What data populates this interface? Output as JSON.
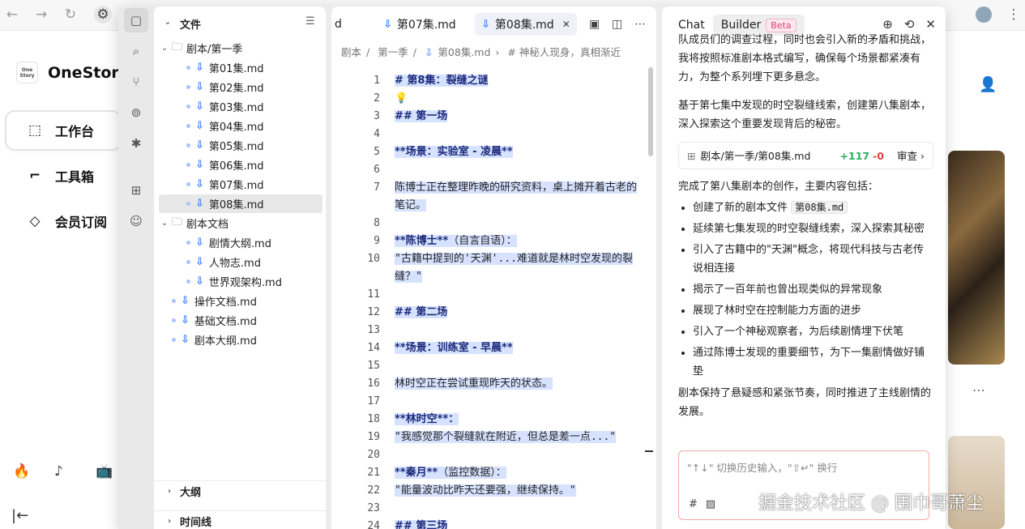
{
  "background": {
    "logo_small": "One Story",
    "logo_text": "OneStory",
    "menu": [
      "工作台",
      "工具箱",
      "会员订阅"
    ]
  },
  "explorer": {
    "header": "文件",
    "tree": [
      {
        "label": "剧本/第一季",
        "kind": "folder-open",
        "level": 0
      },
      {
        "label": "第01集.md",
        "kind": "file",
        "level": 1
      },
      {
        "label": "第02集.md",
        "kind": "file",
        "level": 1
      },
      {
        "label": "第03集.md",
        "kind": "file",
        "level": 1
      },
      {
        "label": "第04集.md",
        "kind": "file",
        "level": 1
      },
      {
        "label": "第05集.md",
        "kind": "file",
        "level": 1
      },
      {
        "label": "第06集.md",
        "kind": "file",
        "level": 1
      },
      {
        "label": "第07集.md",
        "kind": "file",
        "level": 1
      },
      {
        "label": "第08集.md",
        "kind": "file",
        "level": 1,
        "selected": true
      },
      {
        "label": "剧本文档",
        "kind": "folder-open",
        "level": 0
      },
      {
        "label": "剧情大纲.md",
        "kind": "file",
        "level": 1
      },
      {
        "label": "人物志.md",
        "kind": "file",
        "level": 1
      },
      {
        "label": "世界观架构.md",
        "kind": "file",
        "level": 1
      },
      {
        "label": "操作文档.md",
        "kind": "file",
        "level": 0
      },
      {
        "label": "基础文档.md",
        "kind": "file",
        "level": 0
      },
      {
        "label": "剧本大纲.md",
        "kind": "file",
        "level": 0
      }
    ],
    "sections": [
      "大纲",
      "时间线"
    ]
  },
  "editor": {
    "tab_prev_fragment": "d",
    "tab_prev": "第07集.md",
    "tab_active": "第08集.md",
    "breadcrumb": [
      "剧本",
      "第一季",
      "第08集.md",
      "# 神秘人现身，真相渐近"
    ],
    "lines": [
      {
        "n": "1",
        "text": "# 第8集：裂缝之谜",
        "style": "b"
      },
      {
        "n": "2",
        "text": "💡",
        "style": "bulb"
      },
      {
        "n": "3",
        "text": "## 第一场",
        "style": "b"
      },
      {
        "n": "4",
        "text": "",
        "style": ""
      },
      {
        "n": "5",
        "text": "**场景：实验室 - 凌晨**",
        "style": "b"
      },
      {
        "n": "6",
        "text": "",
        "style": ""
      },
      {
        "n": "7",
        "text": "陈博士正在整理昨晚的研究资料，桌上摊开着古老的",
        "cont": "笔记。",
        "style": ""
      },
      {
        "n": "8",
        "text": "",
        "style": ""
      },
      {
        "n": "9",
        "text": "**陈博士**",
        "suffix": "（自言自语）：",
        "style": "b"
      },
      {
        "n": "10",
        "text": "\"古籍中提到的'天渊'...难道就是林时空发现的裂",
        "cont": "缝？\"",
        "style": "mono"
      },
      {
        "n": "11",
        "text": "",
        "style": ""
      },
      {
        "n": "12",
        "text": "## 第二场",
        "style": "b"
      },
      {
        "n": "13",
        "text": "",
        "style": ""
      },
      {
        "n": "14",
        "text": "**场景：训练室 - 早晨**",
        "style": "b"
      },
      {
        "n": "15",
        "text": "",
        "style": ""
      },
      {
        "n": "16",
        "text": "林时空正在尝试重现昨天的状态。",
        "style": ""
      },
      {
        "n": "17",
        "text": "",
        "style": ""
      },
      {
        "n": "18",
        "text": "**林时空**：",
        "style": "b"
      },
      {
        "n": "19",
        "text": "\"我感觉那个裂缝就在附近，但总是差一点...\"",
        "style": "mono"
      },
      {
        "n": "20",
        "text": "",
        "style": ""
      },
      {
        "n": "21",
        "text": "**秦月**",
        "suffix": "（监控数据）：",
        "style": "b"
      },
      {
        "n": "22",
        "text": "\"能量波动比昨天还要强，继续保持。\"",
        "style": "mono"
      },
      {
        "n": "23",
        "text": "",
        "style": ""
      },
      {
        "n": "24",
        "text": "## 第三场",
        "style": "b"
      }
    ]
  },
  "chat": {
    "tab_chat": "Chat",
    "tab_builder": "Builder",
    "beta": "Beta",
    "intro_fragment": "队成员们的调查过程，同时也会引入新的矛盾和挑战，我将按照标准剧本格式编写，确保每个场景都紧凑有力，为整个系列埋下更多悬念。",
    "para2": "基于第七集中发现的时空裂缝线索，创建第八集剧本，深入探索这个重要发现背后的秘密。",
    "file_path": "剧本/第一季/第08集.md",
    "added": "+117",
    "removed": "-0",
    "review": "审查",
    "summary_lead": "完成了第八集剧本的创作，主要内容包括：",
    "bullet_first_prefix": "创建了新的剧本文件",
    "bullet_first_chip": "第08集.md",
    "bullets": [
      "延续第七集发现的时空裂缝线索，深入探索其秘密",
      "引入了古籍中的\"天渊\"概念，将现代科技与古老传说相连接",
      "揭示了一百年前也曾出现类似的异常现象",
      "展现了林时空在控制能力方面的进步",
      "引入了一个神秘观察者，为后续剧情埋下伏笔",
      "通过陈博士发现的重要细节，为下一集剧情做好铺垫"
    ],
    "closing": "剧本保持了悬疑感和紧张节奏，同时推进了主线剧情的发展。",
    "input_placeholder": "\"↑↓\" 切换历史输入，\"⇧↵\" 换行"
  },
  "watermark": "掘金技术社区 @ 围巾哥萧尘",
  "colors": {
    "accent": "#2f78ff",
    "selection": "#d6e2ff",
    "added": "#2bb05e",
    "removed": "#e0443b",
    "beta": "#e03b6f"
  }
}
